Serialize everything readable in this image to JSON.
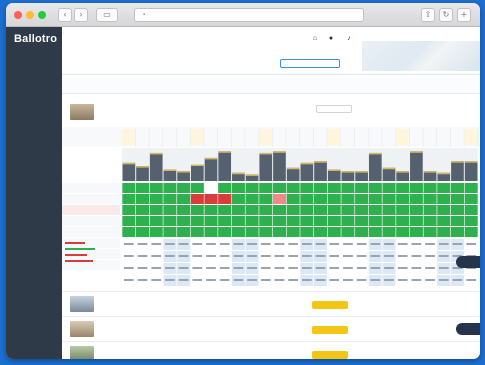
{
  "browser": {
    "url": "",
    "back_label": "‹",
    "forward_label": "›",
    "colors": {
      "close": "#fe5f57",
      "min": "#febc2e",
      "max": "#28c840"
    }
  },
  "sidebar": {
    "logo": "Ballotro",
    "items": [
      {
        "label": "",
        "active": false
      },
      {
        "label": "",
        "active": false
      },
      {
        "label": "",
        "active": true
      },
      {
        "label": "",
        "active": false
      },
      {
        "label": "",
        "active": false
      },
      {
        "label": "",
        "active": false
      },
      {
        "label": "",
        "active": false
      },
      {
        "label": "",
        "active": false
      },
      {
        "label": "",
        "active": false
      },
      {
        "label": "",
        "active": false
      },
      {
        "label": "",
        "active": false
      },
      {
        "label": "",
        "active": false
      },
      {
        "label": "",
        "active": false
      },
      {
        "label": "",
        "active": false
      },
      {
        "label": "",
        "active": false
      },
      {
        "label": "",
        "active": false
      },
      {
        "label": "",
        "active": false
      }
    ]
  },
  "topbar": {
    "breadcrumb": "",
    "property_title": "",
    "date_field": "",
    "icons": [
      {
        "name": "building-icon",
        "glyph": "⌂",
        "caption": ""
      },
      {
        "name": "user-icon",
        "glyph": "●",
        "caption": ""
      },
      {
        "name": "bell-icon",
        "glyph": "♪",
        "caption": ""
      }
    ]
  },
  "filters": {
    "left": "",
    "right": ""
  },
  "room": {
    "name": "",
    "subtitle": "",
    "action_label": "",
    "row_labels": [
      "",
      "",
      "",
      "",
      "",
      "",
      "",
      ""
    ],
    "colors": {
      "available": "#2fb04f",
      "blocked": "#d93c3c",
      "dark": "#56616f",
      "bar_top": "#d4b860",
      "grey": "#7d8791"
    }
  },
  "calendar": {
    "occupancy": [
      0.55,
      0.45,
      0.85,
      0.35,
      0.3,
      0.5,
      0.7,
      0.9,
      0.25,
      0.2,
      0.85,
      0.9,
      0.4,
      0.55,
      0.6,
      0.35,
      0.3,
      0.3,
      0.85,
      0.4,
      0.3,
      0.9,
      0.3,
      0.25,
      0.6,
      0.6
    ],
    "status_row": [
      0,
      0,
      0,
      0,
      0,
      0,
      0,
      0,
      0,
      0,
      0,
      0,
      0,
      0,
      0,
      0,
      0,
      0,
      0,
      0,
      0,
      0,
      0,
      0,
      0,
      0
    ],
    "blocked_row": [
      0,
      0,
      0,
      0,
      0,
      1,
      1,
      1,
      0,
      0,
      0,
      0,
      0,
      0,
      0,
      0,
      0,
      0,
      0,
      0,
      0,
      0,
      0,
      0,
      0,
      0
    ]
  },
  "other_rooms": [
    {
      "name": "",
      "action_label": ""
    },
    {
      "name": "",
      "action_label": ""
    },
    {
      "name": "",
      "action_label": ""
    }
  ],
  "floating": {
    "save_label": "",
    "save2_label": ""
  }
}
